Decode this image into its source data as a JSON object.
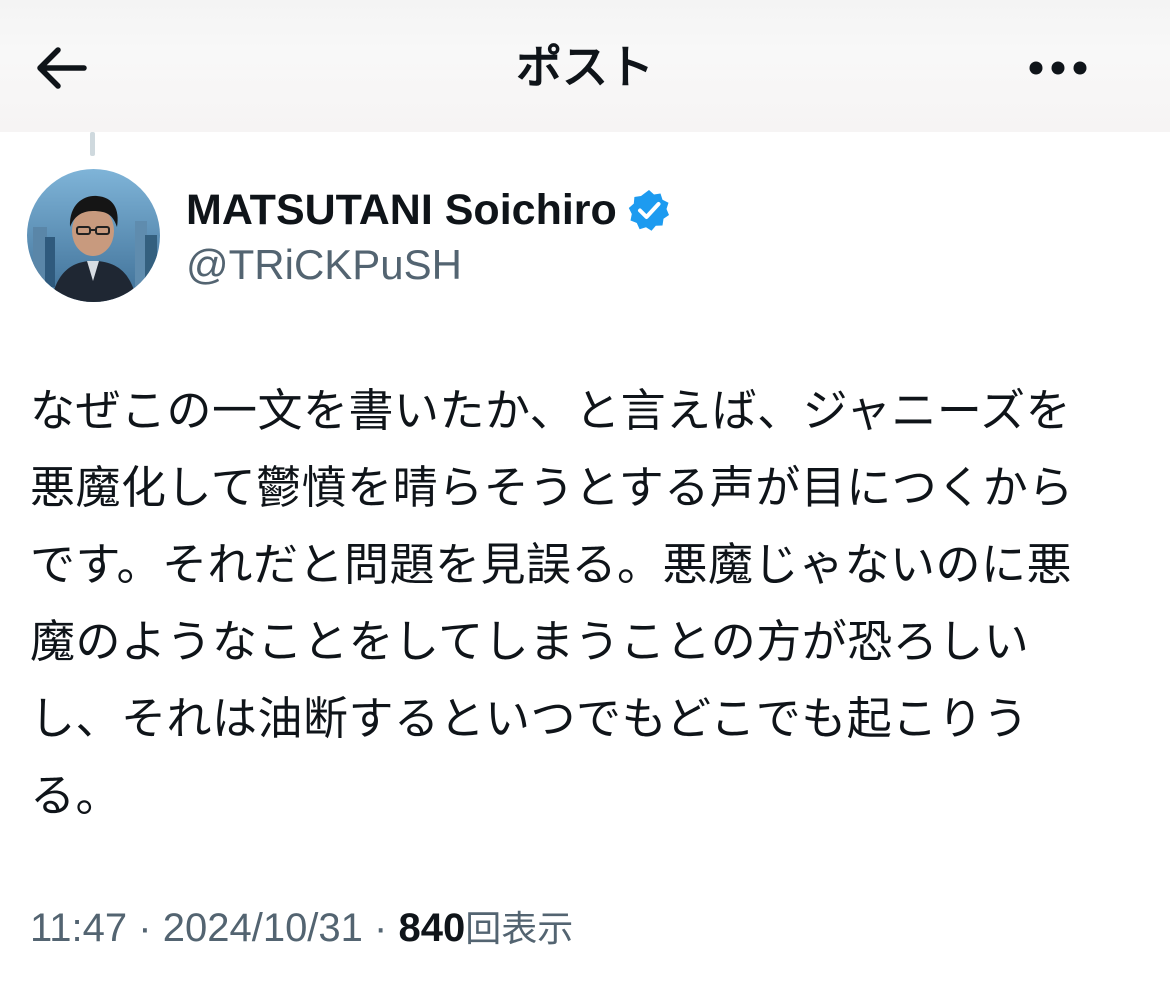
{
  "header": {
    "title": "ポスト",
    "back_icon": "arrow-left-icon",
    "more_icon": "more-horizontal-icon"
  },
  "author": {
    "name": "MATSUTANI Soichiro",
    "handle": "@TRiCKPuSH",
    "verified": true,
    "verified_color": "#1d9bf0"
  },
  "post": {
    "lines": [
      "なぜこの一文を書いたか、と言えば、ジャニーズを",
      "悪魔化して鬱憤を晴らそうとする声が目につくから",
      "です。それだと問題を見誤る。悪魔じゃないのに悪",
      "魔のようなことをしてしまうことの方が恐ろしい",
      "し、それは油断するといつでもどこでも起こりう",
      "る。"
    ]
  },
  "meta": {
    "time": "11:47",
    "separator": "·",
    "date": "2024/10/31",
    "view_count": "840",
    "view_label": "回表示"
  },
  "colors": {
    "text_primary": "#0f1419",
    "text_secondary": "#536471",
    "accent": "#1d9bf0"
  }
}
